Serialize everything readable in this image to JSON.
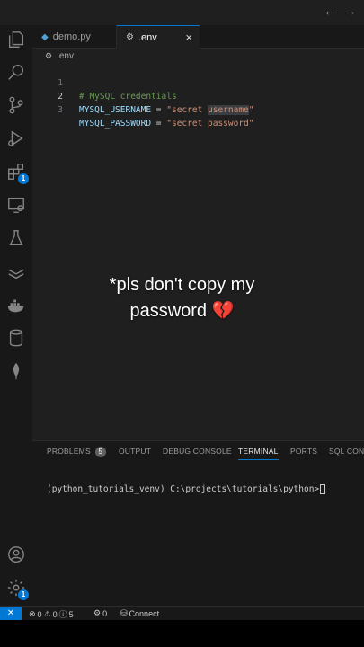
{
  "titlebar": {
    "back": "←",
    "forward": "→"
  },
  "activity_bar": {
    "items": [
      {
        "icon": "explorer-icon"
      },
      {
        "icon": "search-icon"
      },
      {
        "icon": "source-control-icon"
      },
      {
        "icon": "run-debug-icon"
      },
      {
        "icon": "extensions-icon",
        "badge": "1"
      },
      {
        "icon": "remote-explorer-icon"
      },
      {
        "icon": "testing-icon"
      },
      {
        "icon": "layers-icon"
      },
      {
        "icon": "docker-icon"
      },
      {
        "icon": "database-icon"
      },
      {
        "icon": "mongodb-leaf-icon"
      }
    ],
    "bottom": [
      {
        "icon": "account-icon"
      },
      {
        "icon": "manage-gear-icon",
        "badge": "1"
      }
    ]
  },
  "tabs": [
    {
      "label": "demo.py",
      "icon": "python-file-icon"
    },
    {
      "label": ".env",
      "icon": "gear-file-icon",
      "close": "×"
    }
  ],
  "breadcrumb": {
    "label": ".env"
  },
  "code": {
    "lines": [
      {
        "num": "1",
        "comment": "# MySQL credentials"
      },
      {
        "num": "2",
        "key": "MYSQL_USERNAME",
        "op": " = ",
        "str_before": "\"secret ",
        "str_sel": "username",
        "str_after": "\""
      },
      {
        "num": "3",
        "key": "MYSQL_PASSWORD",
        "op": " = ",
        "str": "\"secret password\""
      }
    ]
  },
  "overlay": {
    "line1": "*pls don't copy my",
    "line2": "password",
    "emoji": "💔"
  },
  "panel": {
    "tabs": [
      {
        "label": "PROBLEMS",
        "badge": "5"
      },
      {
        "label": "OUTPUT"
      },
      {
        "label": "DEBUG CONSOLE"
      },
      {
        "label": "TERMINAL"
      },
      {
        "label": "PORTS"
      },
      {
        "label": "SQL CONS"
      }
    ],
    "terminal_prompt": "(python_tutorials_venv) C:\\projects\\tutorials\\python>"
  },
  "statusbar": {
    "remote": "✕",
    "errors": "0",
    "warnings": "0",
    "info": "5",
    "ports": "0",
    "connect": "Connect"
  },
  "colors": {
    "accent": "#0078d4",
    "comment": "#6a9955",
    "key": "#9cdcfe",
    "string": "#ce9178"
  }
}
